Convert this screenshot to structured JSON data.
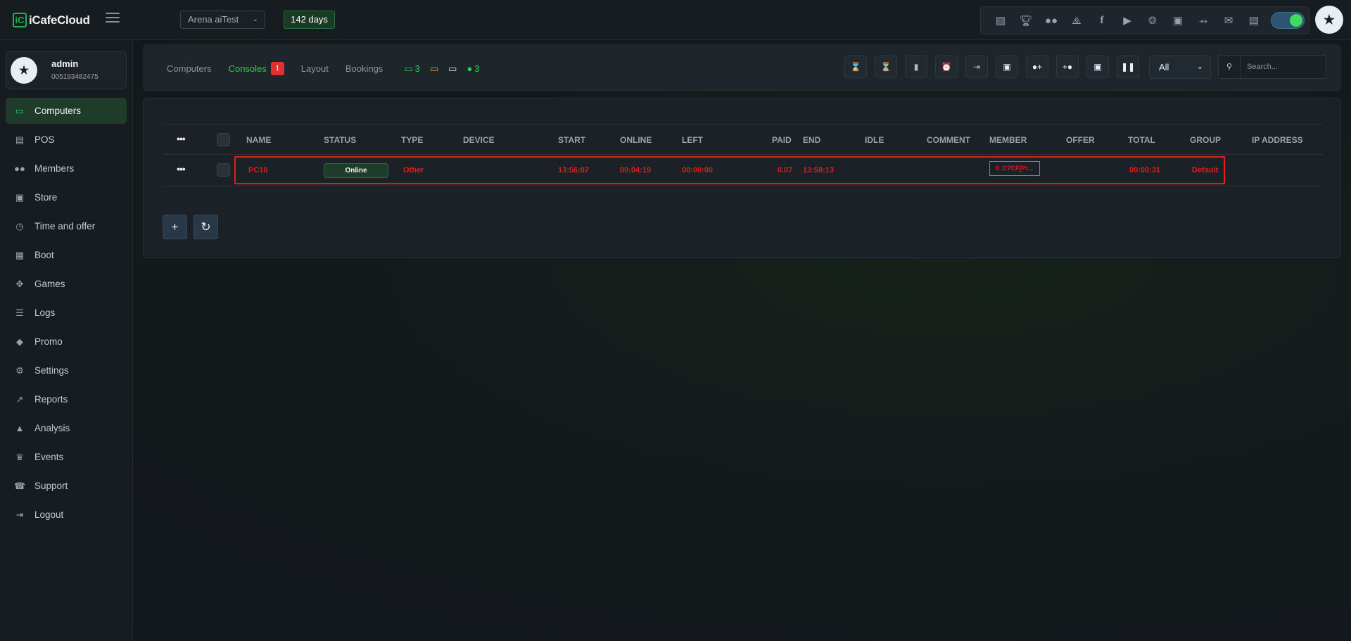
{
  "app": {
    "logo_mark": "iC",
    "logo_text": "iCafeCloud"
  },
  "topbar": {
    "cafe_name": "Arena aiTest",
    "days_badge": "142 days",
    "icons": [
      "leaderboard-icon",
      "trophy-icon",
      "group-icon",
      "rss-icon",
      "facebook-icon",
      "youtube-icon",
      "globe-icon",
      "icafe-icon",
      "handshake-icon",
      "mail-icon",
      "chat-icon"
    ],
    "toggle_on": true
  },
  "profile": {
    "name": "admin",
    "phone": "005193482475"
  },
  "sidebar": {
    "items": [
      {
        "label": "Computers",
        "icon": "monitor-icon",
        "active": true
      },
      {
        "label": "POS",
        "icon": "register-icon"
      },
      {
        "label": "Members",
        "icon": "members-icon"
      },
      {
        "label": "Store",
        "icon": "bag-icon"
      },
      {
        "label": "Time and offer",
        "icon": "stopwatch-icon"
      },
      {
        "label": "Boot",
        "icon": "windows-icon"
      },
      {
        "label": "Games",
        "icon": "gamepad-icon"
      },
      {
        "label": "Logs",
        "icon": "list-icon"
      },
      {
        "label": "Promo",
        "icon": "tag-icon"
      },
      {
        "label": "Settings",
        "icon": "gear-icon"
      },
      {
        "label": "Reports",
        "icon": "line-chart-icon"
      },
      {
        "label": "Analysis",
        "icon": "area-chart-icon"
      },
      {
        "label": "Events",
        "icon": "crown-icon"
      },
      {
        "label": "Support",
        "icon": "phone-icon"
      },
      {
        "label": "Logout",
        "icon": "logout-icon"
      }
    ]
  },
  "tabs": {
    "computers": "Computers",
    "consoles": "Consoles",
    "consoles_badge": "1",
    "layout": "Layout",
    "bookings": "Bookings"
  },
  "stats": {
    "online_count": "3",
    "members_count": "3"
  },
  "actions": {
    "icons": [
      "hourglass-filled-icon",
      "hourglass-icon",
      "lock-icon",
      "alarm-icon",
      "exit-icon",
      "money-icon",
      "user-login-icon",
      "user-add-icon",
      "screenshot-icon",
      "pause-icon"
    ]
  },
  "filter": {
    "selected": "All"
  },
  "search": {
    "placeholder": "Search..."
  },
  "table": {
    "headers": [
      "NAME",
      "STATUS",
      "TYPE",
      "DEVICE",
      "START",
      "ONLINE",
      "LEFT",
      "PAID",
      "END",
      "IDLE",
      "COMMENT",
      "MEMBER",
      "OFFER",
      "TOTAL",
      "GROUP",
      "IP ADDRESS"
    ],
    "rows": [
      {
        "name": "PC10",
        "status": "Online",
        "type": "Other",
        "device": "",
        "start": "13:56:07",
        "online": "00:04:19",
        "left": "00:00:00",
        "paid": "0.07",
        "end": "13:58:13",
        "idle": "",
        "comment": "",
        "member": "0_C7CF[Pr...",
        "offer": "",
        "total": "00:00:31",
        "group": "Default",
        "ip": ""
      }
    ]
  },
  "colors": {
    "accent": "#2ecc59",
    "danger": "#e21b1b",
    "background": "#13171c"
  }
}
